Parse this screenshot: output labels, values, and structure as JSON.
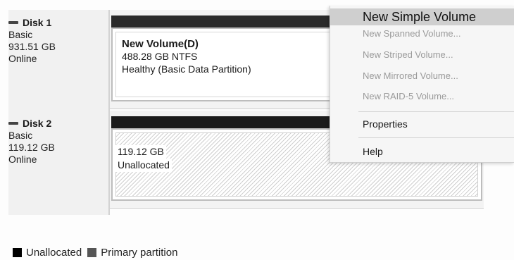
{
  "disks": [
    {
      "name": "Disk 1",
      "type": "Basic",
      "size": "931.51 GB",
      "status": "Online",
      "partition": {
        "title": "New Volume(D)",
        "detail": "488.28 GB NTFS",
        "health": "Healthy (Basic Data Partition)"
      }
    },
    {
      "name": "Disk 2",
      "type": "Basic",
      "size": "119.12 GB",
      "status": "Online",
      "partition": {
        "size": "119.12 GB",
        "state": "Unallocated"
      }
    }
  ],
  "context_menu": {
    "new_simple_volume": "New Simple Volume",
    "new_spanned_volume": "New Spanned Volume...",
    "new_striped_volume": "New Striped Volume...",
    "new_mirrored_volume": "New Mirrored Volume...",
    "new_raid5_volume": "New RAID-5 Volume...",
    "properties": "Properties",
    "help": "Help"
  },
  "legend": {
    "unallocated": "Unallocated",
    "primary_partition": "Primary partition"
  },
  "colors": {
    "unallocated_swatch": "#000000",
    "primary_swatch": "#555555",
    "menu_highlight": "#cfcfcf"
  }
}
